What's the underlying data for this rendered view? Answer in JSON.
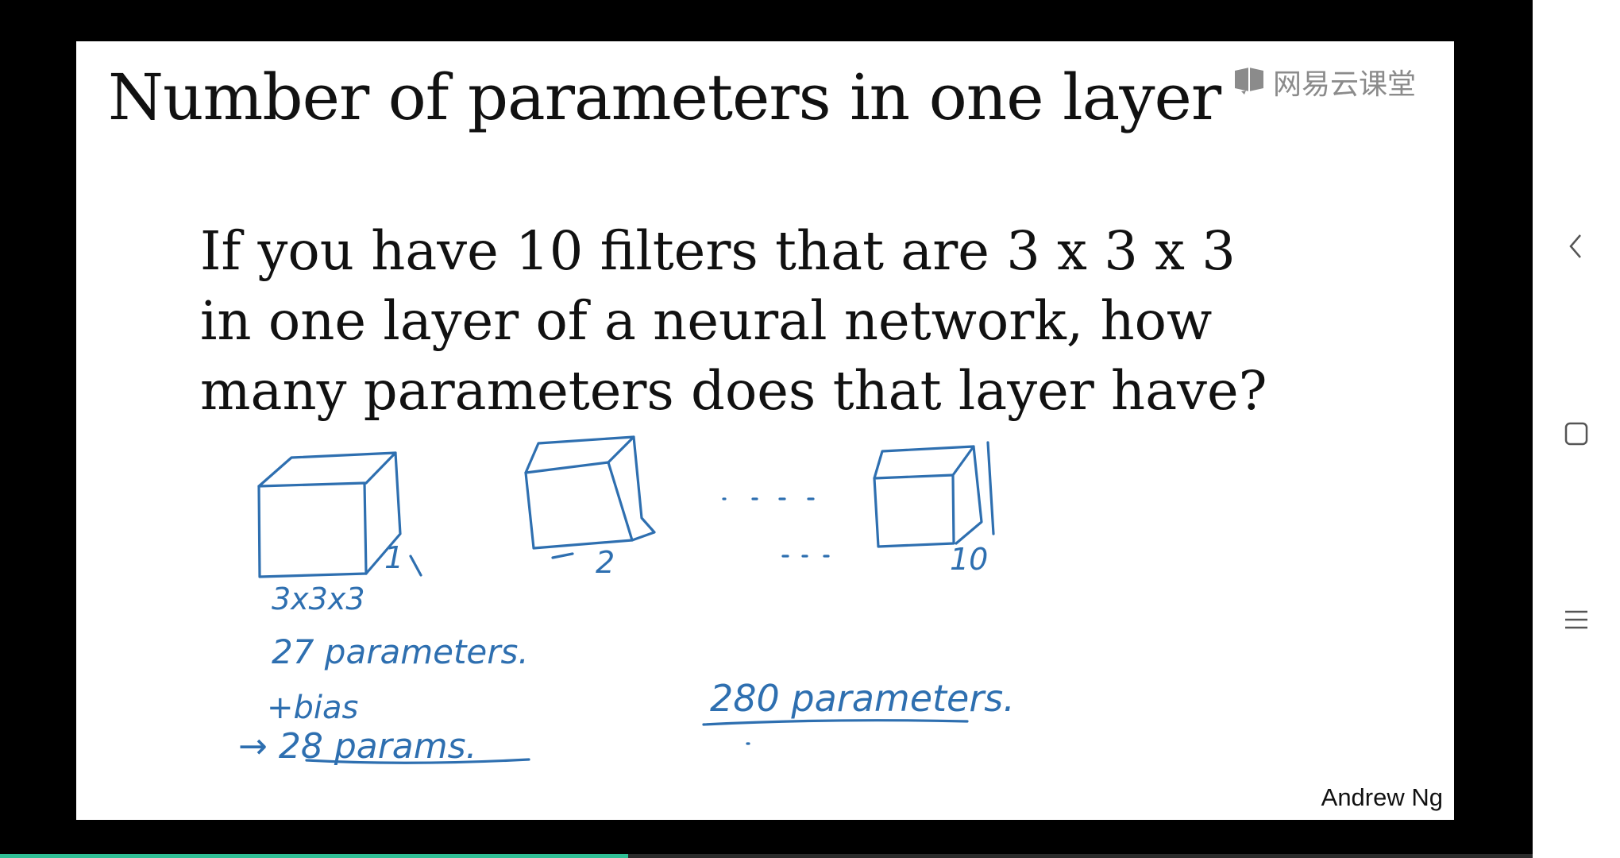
{
  "slide": {
    "title": "Number of parameters in one layer",
    "question_lines": [
      "If you have 10 filters that are 3 x 3 x 3",
      "in one layer of a neural network, how",
      "many parameters does that layer have?"
    ],
    "watermark": "网易云课堂",
    "author": "Andrew Ng"
  },
  "annotations": {
    "cube_labels": [
      "1",
      "2",
      "10"
    ],
    "filter_size": "3x3x3",
    "params_line": "27 parameters.",
    "bias_line": "+bias",
    "total_per_filter": "→ 28 params.",
    "total_layer": "280 parameters."
  },
  "video": {
    "progress": 0.41
  },
  "icons": {
    "watermark": "course-logo-icon",
    "back": "chevron-left-icon",
    "home": "square-icon",
    "menu": "menu-icon"
  },
  "colors": {
    "ink": "#2e6fb0",
    "progress": "#2fbf95",
    "watermark": "#8b8b8b"
  }
}
